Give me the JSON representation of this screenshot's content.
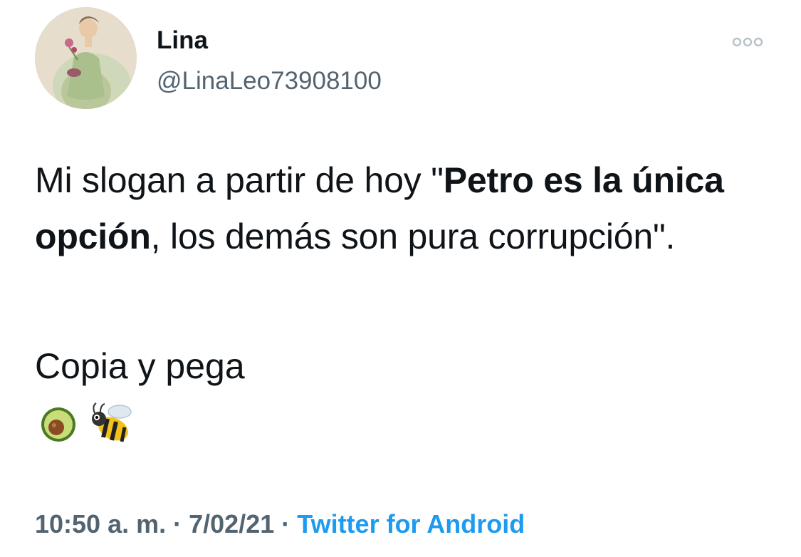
{
  "tweet": {
    "author": {
      "display_name": "Lina",
      "handle": "@LinaLeo73908100"
    },
    "text": {
      "part1": "Mi slogan a partir de hoy \"",
      "bold1": "Petro es la única opción",
      "part2": ", los demás son pura corrupción\".",
      "line2": "Copia y pega"
    },
    "emojis": [
      "avocado-icon",
      "bee-icon"
    ],
    "meta": {
      "time": "10:50 a. m.",
      "separator": "·",
      "date": "7/02/21",
      "source": "Twitter for Android"
    },
    "colors": {
      "text": "#0f1419",
      "secondary": "#536471",
      "link": "#1d9bf0"
    }
  }
}
